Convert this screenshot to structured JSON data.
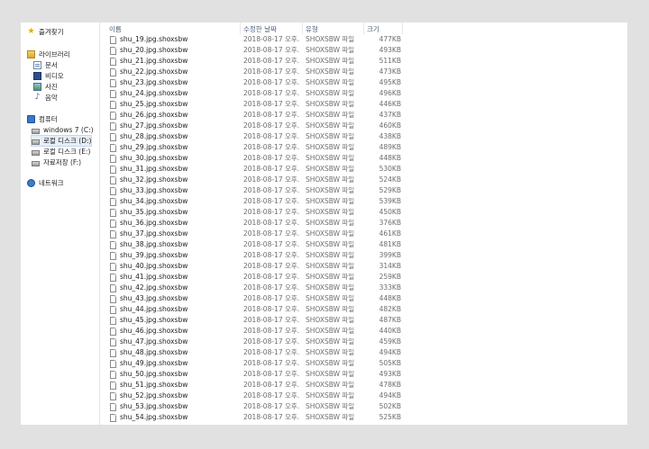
{
  "nav": {
    "favorites": "즐겨찾기",
    "libraries": "라이브러리",
    "documents": "문서",
    "videos": "비디오",
    "pictures": "사진",
    "music": "음악",
    "computer": "컴퓨터",
    "drive_c": "windows 7 (C:)",
    "drive_d": "로컬 디스크 (D:)",
    "drive_e": "로컬 디스크 (E:)",
    "drive_f": "자료저장 (F:)",
    "network": "네트워크",
    "selected": "drive_d"
  },
  "columns": {
    "name": "이름",
    "date": "수정한 날짜",
    "type": "유형",
    "size": "크기"
  },
  "files": [
    {
      "name": "shu_19.jpg.shoxsbw",
      "date": "2018-08-17 오후...",
      "type": "SHOXSBW 파일",
      "size": "477KB"
    },
    {
      "name": "shu_20.jpg.shoxsbw",
      "date": "2018-08-17 오후...",
      "type": "SHOXSBW 파일",
      "size": "493KB"
    },
    {
      "name": "shu_21.jpg.shoxsbw",
      "date": "2018-08-17 오후...",
      "type": "SHOXSBW 파일",
      "size": "511KB"
    },
    {
      "name": "shu_22.jpg.shoxsbw",
      "date": "2018-08-17 오후...",
      "type": "SHOXSBW 파일",
      "size": "473KB"
    },
    {
      "name": "shu_23.jpg.shoxsbw",
      "date": "2018-08-17 오후...",
      "type": "SHOXSBW 파일",
      "size": "495KB"
    },
    {
      "name": "shu_24.jpg.shoxsbw",
      "date": "2018-08-17 오후...",
      "type": "SHOXSBW 파일",
      "size": "496KB"
    },
    {
      "name": "shu_25.jpg.shoxsbw",
      "date": "2018-08-17 오후...",
      "type": "SHOXSBW 파일",
      "size": "446KB"
    },
    {
      "name": "shu_26.jpg.shoxsbw",
      "date": "2018-08-17 오후...",
      "type": "SHOXSBW 파일",
      "size": "437KB"
    },
    {
      "name": "shu_27.jpg.shoxsbw",
      "date": "2018-08-17 오후...",
      "type": "SHOXSBW 파일",
      "size": "460KB"
    },
    {
      "name": "shu_28.jpg.shoxsbw",
      "date": "2018-08-17 오후...",
      "type": "SHOXSBW 파일",
      "size": "438KB"
    },
    {
      "name": "shu_29.jpg.shoxsbw",
      "date": "2018-08-17 오후...",
      "type": "SHOXSBW 파일",
      "size": "489KB"
    },
    {
      "name": "shu_30.jpg.shoxsbw",
      "date": "2018-08-17 오후...",
      "type": "SHOXSBW 파일",
      "size": "448KB"
    },
    {
      "name": "shu_31.jpg.shoxsbw",
      "date": "2018-08-17 오후...",
      "type": "SHOXSBW 파일",
      "size": "530KB"
    },
    {
      "name": "shu_32.jpg.shoxsbw",
      "date": "2018-08-17 오후...",
      "type": "SHOXSBW 파일",
      "size": "524KB"
    },
    {
      "name": "shu_33.jpg.shoxsbw",
      "date": "2018-08-17 오후...",
      "type": "SHOXSBW 파일",
      "size": "529KB"
    },
    {
      "name": "shu_34.jpg.shoxsbw",
      "date": "2018-08-17 오후...",
      "type": "SHOXSBW 파일",
      "size": "539KB"
    },
    {
      "name": "shu_35.jpg.shoxsbw",
      "date": "2018-08-17 오후...",
      "type": "SHOXSBW 파일",
      "size": "450KB"
    },
    {
      "name": "shu_36.jpg.shoxsbw",
      "date": "2018-08-17 오후...",
      "type": "SHOXSBW 파일",
      "size": "376KB"
    },
    {
      "name": "shu_37.jpg.shoxsbw",
      "date": "2018-08-17 오후...",
      "type": "SHOXSBW 파일",
      "size": "461KB"
    },
    {
      "name": "shu_38.jpg.shoxsbw",
      "date": "2018-08-17 오후...",
      "type": "SHOXSBW 파일",
      "size": "481KB"
    },
    {
      "name": "shu_39.jpg.shoxsbw",
      "date": "2018-08-17 오후...",
      "type": "SHOXSBW 파일",
      "size": "399KB"
    },
    {
      "name": "shu_40.jpg.shoxsbw",
      "date": "2018-08-17 오후...",
      "type": "SHOXSBW 파일",
      "size": "314KB"
    },
    {
      "name": "shu_41.jpg.shoxsbw",
      "date": "2018-08-17 오후...",
      "type": "SHOXSBW 파일",
      "size": "259KB"
    },
    {
      "name": "shu_42.jpg.shoxsbw",
      "date": "2018-08-17 오후...",
      "type": "SHOXSBW 파일",
      "size": "333KB"
    },
    {
      "name": "shu_43.jpg.shoxsbw",
      "date": "2018-08-17 오후...",
      "type": "SHOXSBW 파일",
      "size": "448KB"
    },
    {
      "name": "shu_44.jpg.shoxsbw",
      "date": "2018-08-17 오후...",
      "type": "SHOXSBW 파일",
      "size": "482KB"
    },
    {
      "name": "shu_45.jpg.shoxsbw",
      "date": "2018-08-17 오후...",
      "type": "SHOXSBW 파일",
      "size": "487KB"
    },
    {
      "name": "shu_46.jpg.shoxsbw",
      "date": "2018-08-17 오후...",
      "type": "SHOXSBW 파일",
      "size": "440KB"
    },
    {
      "name": "shu_47.jpg.shoxsbw",
      "date": "2018-08-17 오후...",
      "type": "SHOXSBW 파일",
      "size": "459KB"
    },
    {
      "name": "shu_48.jpg.shoxsbw",
      "date": "2018-08-17 오후...",
      "type": "SHOXSBW 파일",
      "size": "494KB"
    },
    {
      "name": "shu_49.jpg.shoxsbw",
      "date": "2018-08-17 오후...",
      "type": "SHOXSBW 파일",
      "size": "505KB"
    },
    {
      "name": "shu_50.jpg.shoxsbw",
      "date": "2018-08-17 오후...",
      "type": "SHOXSBW 파일",
      "size": "493KB"
    },
    {
      "name": "shu_51.jpg.shoxsbw",
      "date": "2018-08-17 오후...",
      "type": "SHOXSBW 파일",
      "size": "478KB"
    },
    {
      "name": "shu_52.jpg.shoxsbw",
      "date": "2018-08-17 오후...",
      "type": "SHOXSBW 파일",
      "size": "494KB"
    },
    {
      "name": "shu_53.jpg.shoxsbw",
      "date": "2018-08-17 오후...",
      "type": "SHOXSBW 파일",
      "size": "502KB"
    },
    {
      "name": "shu_54.jpg.shoxsbw",
      "date": "2018-08-17 오후...",
      "type": "SHOXSBW 파일",
      "size": "525KB"
    }
  ]
}
